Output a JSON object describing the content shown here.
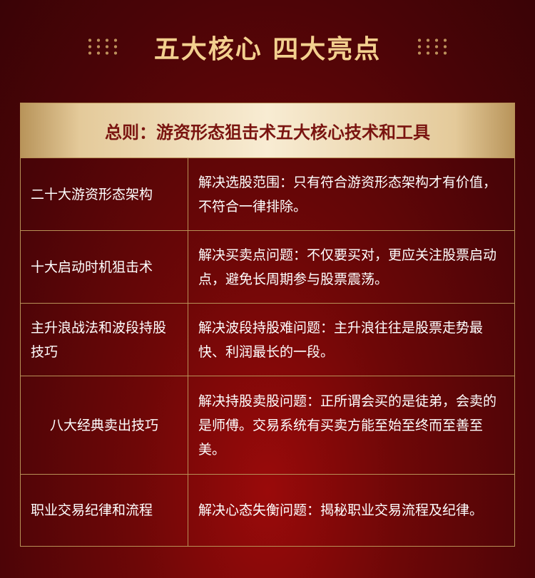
{
  "header": {
    "title": "五大核心 四大亮点"
  },
  "banner": {
    "text": "总则：游资形态狙击术五大核心技术和工具"
  },
  "rows": [
    {
      "left": "二十大游资形态架构",
      "right": "解决选股范围：只有符合游资形态架构才有价值，不符合一律排除。"
    },
    {
      "left": "十大启动时机狙击术",
      "right": "解决买卖点问题：不仅要买对，更应关注股票启动点，避免长周期参与股票震荡。"
    },
    {
      "left": "主升浪战法和波段持股技巧",
      "right": "解决波段持股难问题：主升浪往往是股票走势最快、利润最长的一段。"
    },
    {
      "left": "八大经典卖出技巧",
      "right": "解决持股卖股问题：正所谓会买的是徒弟，会卖的是师傅。交易系统有买卖方能至始至终而至善至美。"
    },
    {
      "left": "职业交易纪律和流程",
      "right": "解决心态失衡问题：揭秘职业交易流程及纪律。"
    }
  ],
  "colors": {
    "background": "#6e0707",
    "gold": "#f3d08f",
    "banner_text": "#7a1410",
    "border": "#b89157"
  }
}
